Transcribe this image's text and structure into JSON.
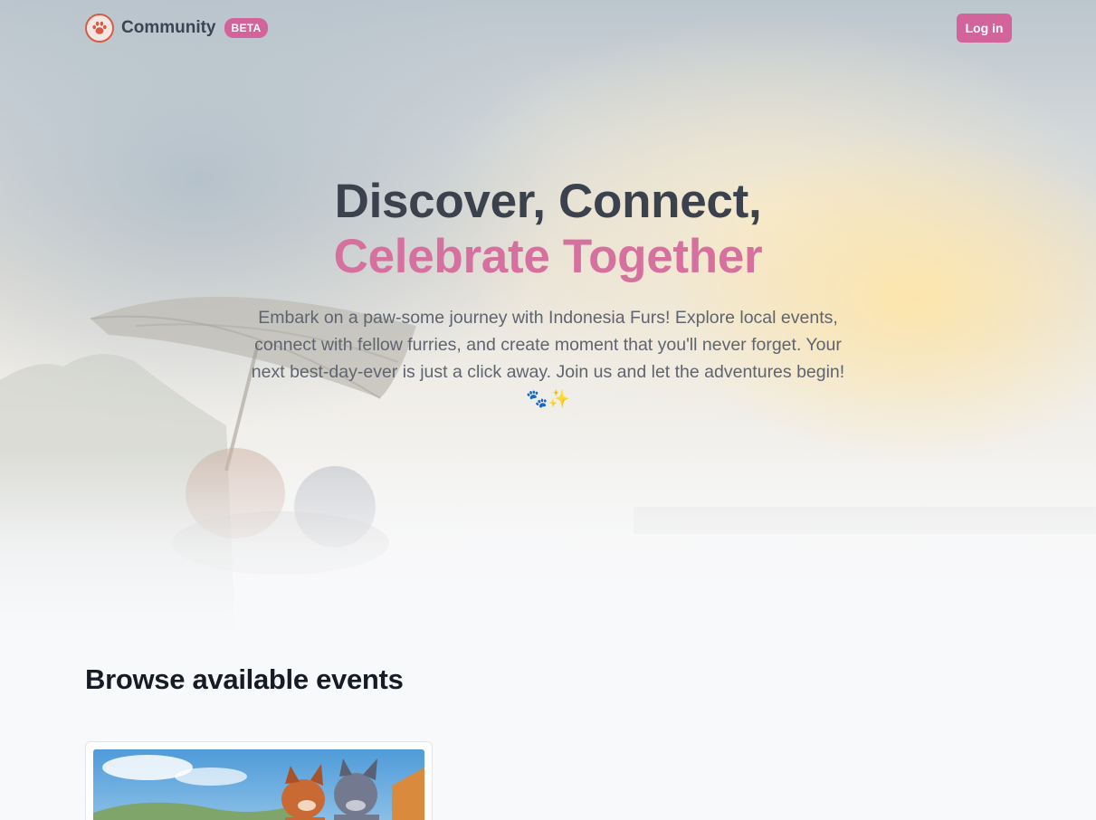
{
  "navbar": {
    "brand": "Community",
    "badge": "BETA",
    "login_label": "Log in",
    "logo_icon": "paw-icon"
  },
  "hero": {
    "title_line1": "Discover, Connect,",
    "title_line2": "Celebrate Together",
    "subtitle": "Embark on a paw-some journey with Indonesia Furs! Explore local events, connect with fellow furries, and create moment that you'll never forget. Your next best-day-ever is just a click away. Join us and let the adventures begin! 🐾✨"
  },
  "events": {
    "heading": "Browse available events"
  },
  "colors": {
    "accent": "#d2639b",
    "title_dark": "#3b414d",
    "title_pink": "#d6709f",
    "logo_red": "#d95b46"
  }
}
